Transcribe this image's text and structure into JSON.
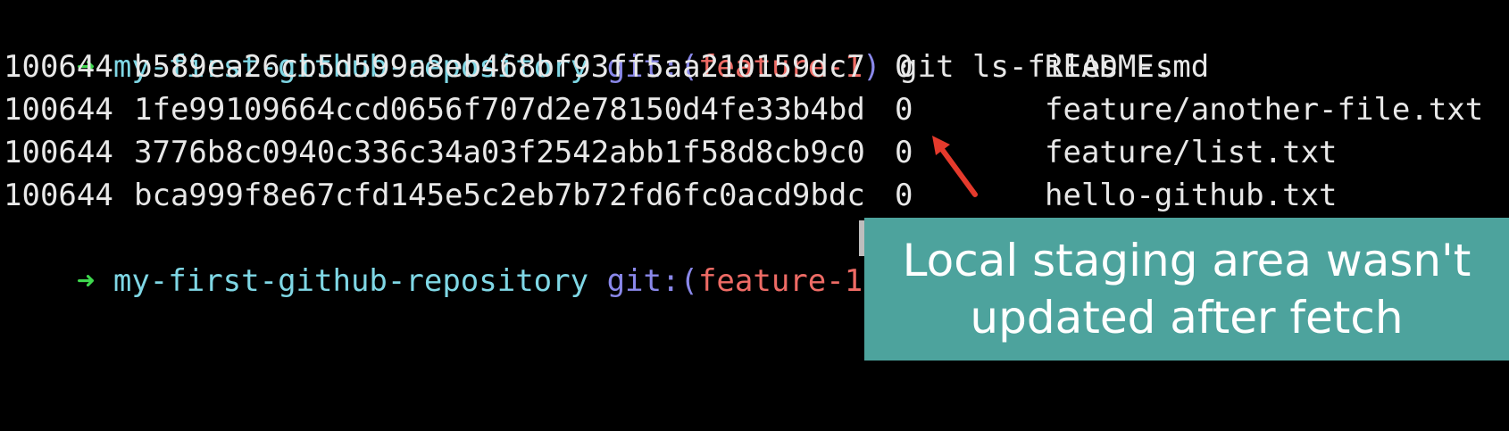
{
  "prompt": {
    "arrow_glyph": "➜",
    "repo": "my-first-github-repository",
    "git_label": "git:",
    "open_paren": "(",
    "branch": "feature-1",
    "close_paren": ")"
  },
  "command": "git ls-files -s",
  "rows": [
    {
      "mode": "100644",
      "hash": "b589ea26cb5d599a8eb468bf93ff5aa210159dc7",
      "stage": "0",
      "path": "README.md"
    },
    {
      "mode": "100644",
      "hash": "1fe99109664ccd0656f707d2e78150d4fe33b4bd",
      "stage": "0",
      "path": "feature/another-file.txt"
    },
    {
      "mode": "100644",
      "hash": "3776b8c0940c336c34a03f2542abb1f58d8cb9c0",
      "stage": "0",
      "path": "feature/list.txt"
    },
    {
      "mode": "100644",
      "hash": "bca999f8e67cfd145e5c2eb7b72fd6fc0acd9bdc",
      "stage": "0",
      "path": "hello-github.txt"
    }
  ],
  "caption": {
    "line1": "Local staging area wasn't",
    "line2": "updated after fetch"
  },
  "colors": {
    "prompt_arrow": "#3ed84e",
    "repo_name": "#7fd7e5",
    "git_label": "#8a88ea",
    "branch": "#ee6b65",
    "caption_bg": "#4da39d",
    "pointer": "#e53a2c"
  }
}
